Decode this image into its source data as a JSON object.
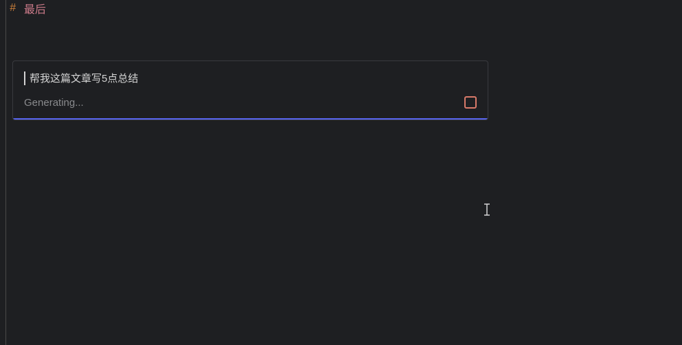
{
  "heading": {
    "hash": "#",
    "text": "最后"
  },
  "prompt": {
    "input_text": "帮我这篇文章写5点总结",
    "status_text": "Generating..."
  }
}
